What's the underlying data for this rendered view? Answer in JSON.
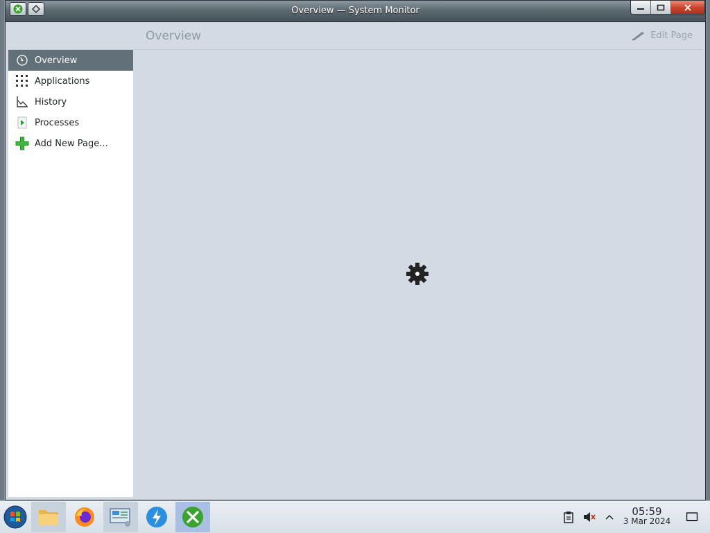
{
  "window": {
    "title": "Overview — System Monitor"
  },
  "sidebar": {
    "items": [
      {
        "label": "Overview",
        "icon": "gauge-icon",
        "active": true
      },
      {
        "label": "Applications",
        "icon": "applications-grid-icon",
        "active": false
      },
      {
        "label": "History",
        "icon": "line-chart-icon",
        "active": false
      },
      {
        "label": "Processes",
        "icon": "processes-icon",
        "active": false
      },
      {
        "label": "Add New Page...",
        "icon": "green-plus-icon",
        "active": false
      }
    ]
  },
  "main": {
    "page_title": "Overview",
    "edit_page_label": "Edit Page",
    "loading_icon": "gear-icon"
  },
  "taskbar": {
    "apps": [
      {
        "name": "start-menu",
        "icon": "start-orb-icon"
      },
      {
        "name": "file-manager",
        "icon": "folder-icon"
      },
      {
        "name": "firefox",
        "icon": "firefox-icon"
      },
      {
        "name": "system-settings",
        "icon": "control-panel-icon"
      },
      {
        "name": "discover",
        "icon": "lightning-icon"
      },
      {
        "name": "system-monitor",
        "icon": "tools-icon"
      }
    ],
    "clock": {
      "time": "05:59",
      "date": "3 Mar 2024"
    }
  },
  "colors": {
    "sidebar_active_bg": "#627079",
    "content_bg": "#d3dae4",
    "taskbar_active": "#a9c0e4"
  }
}
